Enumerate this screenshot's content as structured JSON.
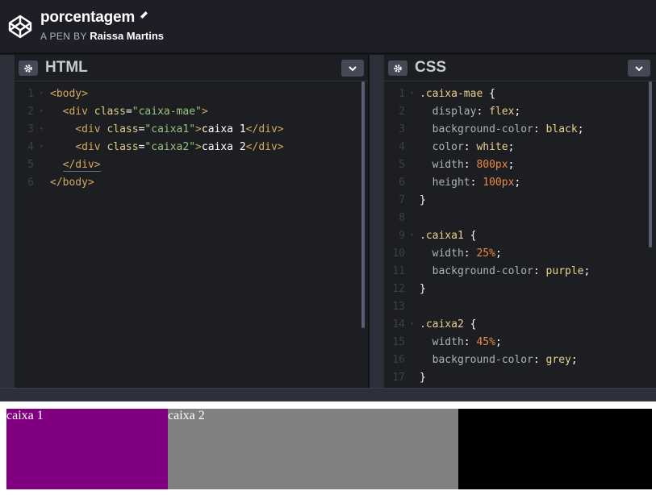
{
  "header": {
    "pen_title": "porcentagem",
    "pen_by": "A PEN BY",
    "author": "Raissa Martins"
  },
  "html_panel": {
    "title": "HTML",
    "lines": [
      {
        "n": "1",
        "fold": "▾",
        "tokens": [
          [
            "t-tag",
            "<body>"
          ]
        ]
      },
      {
        "n": "2",
        "fold": "▾",
        "tokens": [
          [
            "t-txt",
            "  "
          ],
          [
            "t-tag",
            "<div "
          ],
          [
            "t-attr",
            "class"
          ],
          [
            "t-punc",
            "="
          ],
          [
            "t-str",
            "\"caixa-mae\""
          ],
          [
            "t-tag",
            ">"
          ]
        ]
      },
      {
        "n": "3",
        "fold": "▾",
        "tokens": [
          [
            "t-txt",
            "    "
          ],
          [
            "t-tag",
            "<div "
          ],
          [
            "t-attr",
            "class"
          ],
          [
            "t-punc",
            "="
          ],
          [
            "t-str",
            "\"caixa1\""
          ],
          [
            "t-tag",
            ">"
          ],
          [
            "t-txt",
            "caixa 1"
          ],
          [
            "t-tag",
            "</div>"
          ]
        ]
      },
      {
        "n": "4",
        "fold": "▾",
        "tokens": [
          [
            "t-txt",
            "    "
          ],
          [
            "t-tag",
            "<div "
          ],
          [
            "t-attr",
            "class"
          ],
          [
            "t-punc",
            "="
          ],
          [
            "t-str",
            "\"caixa2\""
          ],
          [
            "t-tag",
            ">"
          ],
          [
            "t-txt",
            "caixa 2"
          ],
          [
            "t-tag",
            "</div>"
          ]
        ]
      },
      {
        "n": "5",
        "fold": "",
        "tokens": [
          [
            "t-txt",
            "  "
          ],
          [
            "t-tag t-close-u",
            "</div>"
          ]
        ]
      },
      {
        "n": "6",
        "fold": "",
        "tokens": [
          [
            "t-tag",
            "</body>"
          ]
        ]
      }
    ]
  },
  "css_panel": {
    "title": "CSS",
    "lines": [
      {
        "n": "1",
        "fold": "▾",
        "tokens": [
          [
            "t-sel",
            ".caixa-mae"
          ],
          [
            "t-punc",
            " {"
          ]
        ]
      },
      {
        "n": "2",
        "fold": "",
        "tokens": [
          [
            "t-txt",
            "  "
          ],
          [
            "t-prop",
            "display"
          ],
          [
            "t-punc",
            ": "
          ],
          [
            "t-val",
            "flex"
          ],
          [
            "t-punc",
            ";"
          ]
        ]
      },
      {
        "n": "3",
        "fold": "",
        "tokens": [
          [
            "t-txt",
            "  "
          ],
          [
            "t-prop",
            "background-color"
          ],
          [
            "t-punc",
            ": "
          ],
          [
            "t-val",
            "black"
          ],
          [
            "t-punc",
            ";"
          ]
        ]
      },
      {
        "n": "4",
        "fold": "",
        "tokens": [
          [
            "t-txt",
            "  "
          ],
          [
            "t-prop",
            "color"
          ],
          [
            "t-punc",
            ": "
          ],
          [
            "t-val",
            "white"
          ],
          [
            "t-punc",
            ";"
          ]
        ]
      },
      {
        "n": "5",
        "fold": "",
        "tokens": [
          [
            "t-txt",
            "  "
          ],
          [
            "t-prop",
            "width"
          ],
          [
            "t-punc",
            ": "
          ],
          [
            "t-num",
            "800px"
          ],
          [
            "t-punc",
            ";"
          ]
        ]
      },
      {
        "n": "6",
        "fold": "",
        "tokens": [
          [
            "t-txt",
            "  "
          ],
          [
            "t-prop",
            "height"
          ],
          [
            "t-punc",
            ": "
          ],
          [
            "t-num",
            "100px"
          ],
          [
            "t-punc",
            ";"
          ]
        ]
      },
      {
        "n": "7",
        "fold": "",
        "tokens": [
          [
            "t-punc",
            "}"
          ]
        ]
      },
      {
        "n": "8",
        "fold": "",
        "tokens": []
      },
      {
        "n": "9",
        "fold": "▾",
        "tokens": [
          [
            "t-sel",
            ".caixa1"
          ],
          [
            "t-punc",
            " {"
          ]
        ]
      },
      {
        "n": "10",
        "fold": "",
        "tokens": [
          [
            "t-txt",
            "  "
          ],
          [
            "t-prop",
            "width"
          ],
          [
            "t-punc",
            ": "
          ],
          [
            "t-num",
            "25%"
          ],
          [
            "t-punc",
            ";"
          ]
        ]
      },
      {
        "n": "11",
        "fold": "",
        "tokens": [
          [
            "t-txt",
            "  "
          ],
          [
            "t-prop",
            "background-color"
          ],
          [
            "t-punc",
            ": "
          ],
          [
            "t-val",
            "purple"
          ],
          [
            "t-punc",
            ";"
          ]
        ]
      },
      {
        "n": "12",
        "fold": "",
        "tokens": [
          [
            "t-punc",
            "}"
          ]
        ]
      },
      {
        "n": "13",
        "fold": "",
        "tokens": []
      },
      {
        "n": "14",
        "fold": "▾",
        "tokens": [
          [
            "t-sel",
            ".caixa2"
          ],
          [
            "t-punc",
            " {"
          ]
        ]
      },
      {
        "n": "15",
        "fold": "",
        "tokens": [
          [
            "t-txt",
            "  "
          ],
          [
            "t-prop",
            "width"
          ],
          [
            "t-punc",
            ": "
          ],
          [
            "t-num",
            "45%"
          ],
          [
            "t-punc",
            ";"
          ]
        ]
      },
      {
        "n": "16",
        "fold": "",
        "tokens": [
          [
            "t-txt",
            "  "
          ],
          [
            "t-prop",
            "background-color"
          ],
          [
            "t-punc",
            ": "
          ],
          [
            "t-val",
            "grey"
          ],
          [
            "t-punc",
            ";"
          ]
        ]
      },
      {
        "n": "17",
        "fold": "",
        "tokens": [
          [
            "t-punc",
            "}"
          ]
        ]
      }
    ]
  },
  "preview": {
    "caixa1": "caixa 1",
    "caixa2": "caixa 2"
  },
  "icons": {
    "logo": "codepen-logo-icon",
    "edit": "pencil-icon",
    "settings": "gear-icon",
    "collapse": "chevron-down-icon"
  },
  "colors": {
    "topbar": "#1e1f26",
    "panel": "#1d1e22",
    "button": "#444857",
    "purple": "#800080",
    "grey": "#808080",
    "black": "#000000"
  }
}
